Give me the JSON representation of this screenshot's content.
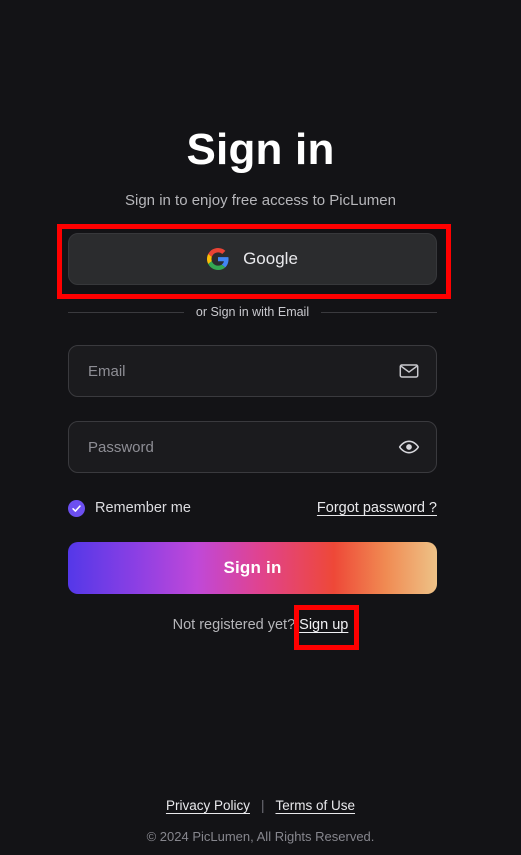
{
  "page": {
    "background_color": "#131316",
    "title": "Sign in",
    "subtitle": "Sign in to enjoy free access to PicLumen"
  },
  "oauth": {
    "google_label": "Google",
    "icon": "google-logo-icon"
  },
  "divider": {
    "text": "or Sign in with Email"
  },
  "form": {
    "email": {
      "placeholder": "Email",
      "value": "",
      "icon": "envelope-icon"
    },
    "password": {
      "placeholder": "Password",
      "value": "",
      "icon": "eye-icon"
    },
    "remember_me": {
      "label": "Remember me",
      "checked": true,
      "accent_color": "#6c4ff0"
    },
    "forgot_password_label": "Forgot password ?",
    "submit_label": "Sign in",
    "submit_gradient": [
      "#5438e8",
      "#c048d8",
      "#ee4838",
      "#eec287"
    ]
  },
  "register": {
    "prompt": "Not registered yet?",
    "link_label": "Sign up"
  },
  "footer": {
    "privacy_label": "Privacy Policy",
    "separator": "|",
    "terms_label": "Terms of Use",
    "copyright": "© 2024 PicLumen, All Rights Reserved."
  },
  "annotations": {
    "highlight_color": "#ff0000",
    "boxes": [
      "google-button",
      "signup-link"
    ]
  }
}
